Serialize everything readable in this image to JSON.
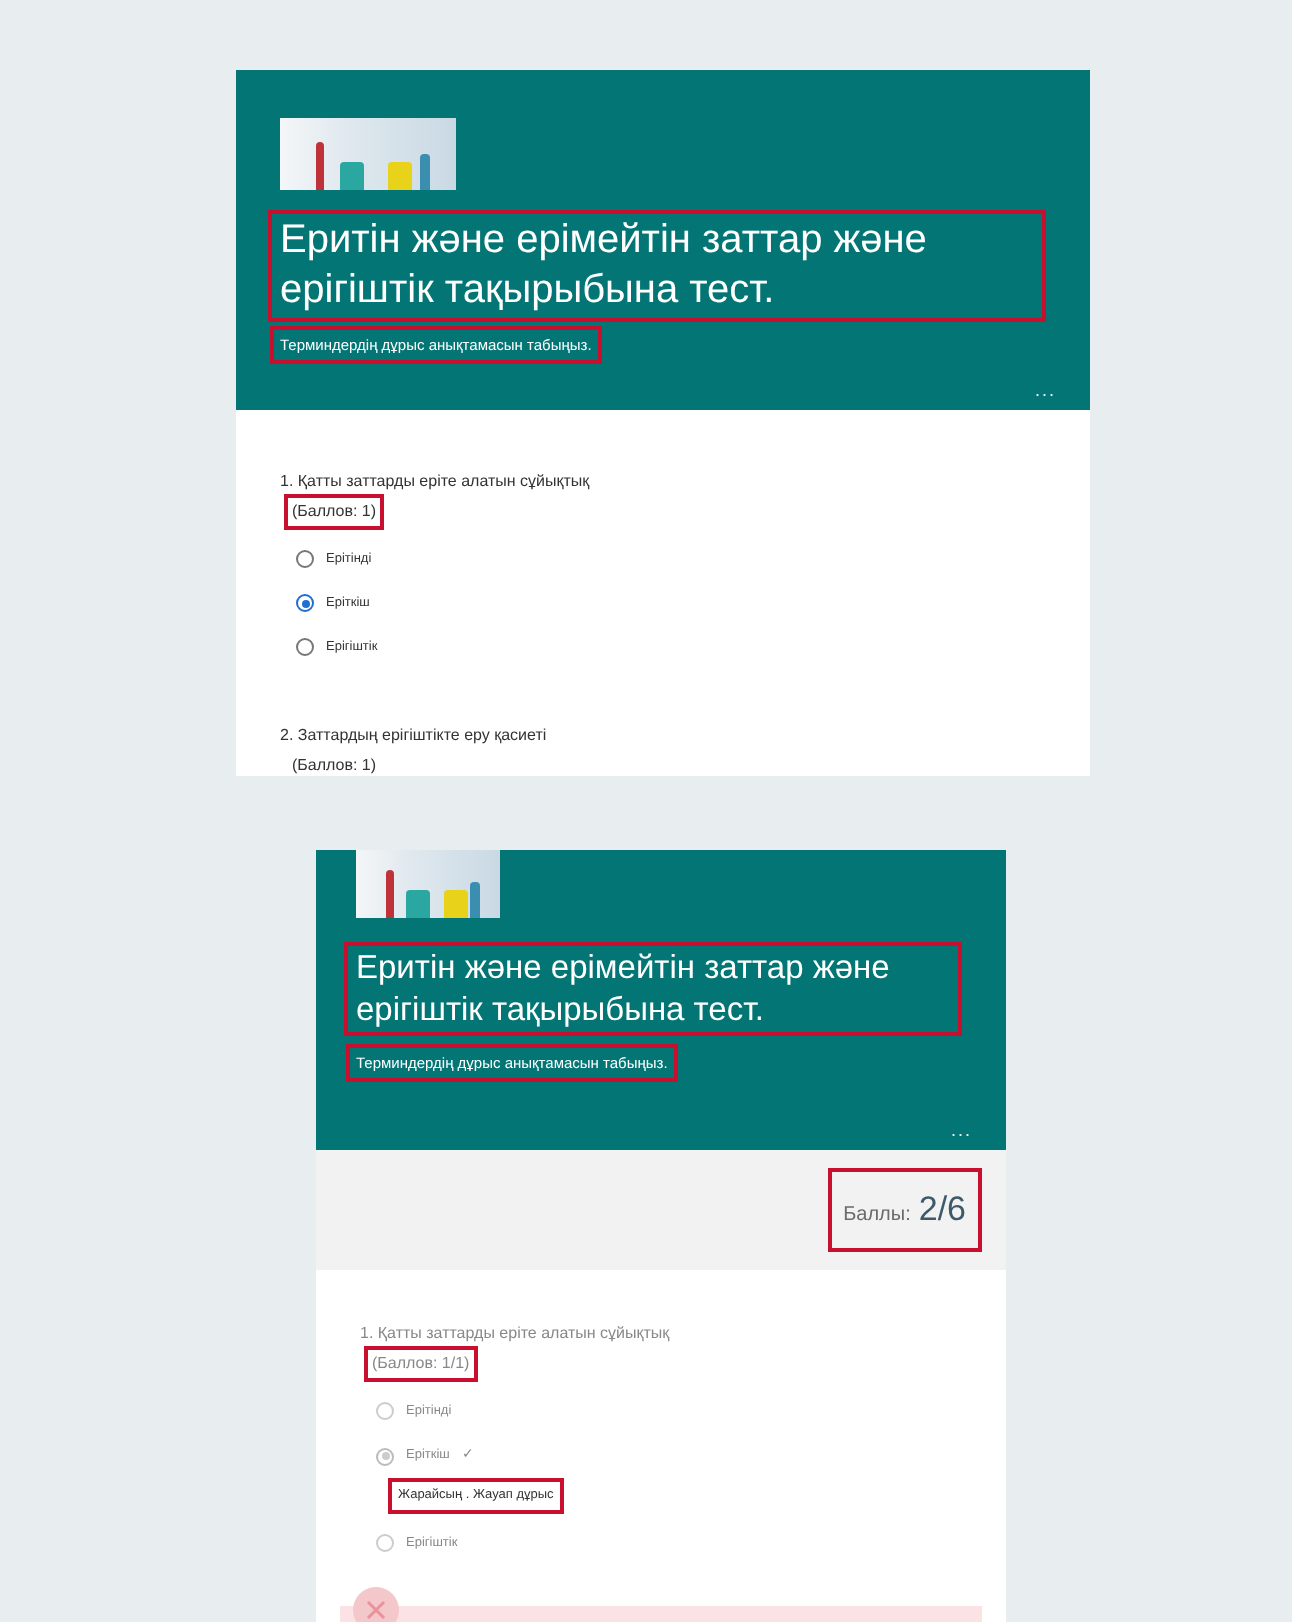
{
  "screenshots": [
    {
      "header": {
        "title": {
          "text": "Еритін және ерімейтін заттар және ерігіштік тақырыбына тест.",
          "marked": true
        },
        "subtitle": {
          "text": "Терминдердің дұрыс анықтамасын табыңыз.",
          "marked": true
        },
        "more": "..."
      },
      "questions": [
        {
          "prompt": "1. Қатты заттарды еріте алатын сұйықтық",
          "points": {
            "text": "(Баллов: 1)",
            "marked": true
          },
          "disabled": false,
          "options": [
            {
              "label": "Ерітінді",
              "selected": false
            },
            {
              "label": "Еріткіш",
              "selected": true
            },
            {
              "label": "Ерігіштік",
              "selected": false
            }
          ]
        },
        {
          "prompt": "2. Заттардың ерігіштікте еру қасиеті",
          "points": {
            "text": "(Баллов: 1)",
            "marked": false
          },
          "disabled": false
        }
      ]
    },
    {
      "header": {
        "title": {
          "text": "Еритін және ерімейтін заттар және ерігіштік тақырыбына тест.",
          "marked": true
        },
        "subtitle": {
          "text": "Терминдердің дұрыс анықтамасын табыңыз.",
          "marked": true
        },
        "more": "..."
      },
      "score": {
        "label": "Баллы:",
        "value": "2/6",
        "marked": true
      },
      "questions": [
        {
          "prompt": "1. Қатты заттарды еріте алатын сұйықтық",
          "points": {
            "text": "(Баллов: 1/1)",
            "marked": true
          },
          "disabled": true,
          "options": [
            {
              "label": "Ерітінді",
              "selected": false
            },
            {
              "label": "Еріткіш",
              "selected": true,
              "check": "✓",
              "feedback": {
                "text": "Жарайсың . Жауап дұрыс",
                "marked": true
              }
            },
            {
              "label": "Ерігіштік",
              "selected": false
            }
          ]
        }
      ],
      "result_banner": {
        "kind": "incorrect"
      }
    }
  ]
}
